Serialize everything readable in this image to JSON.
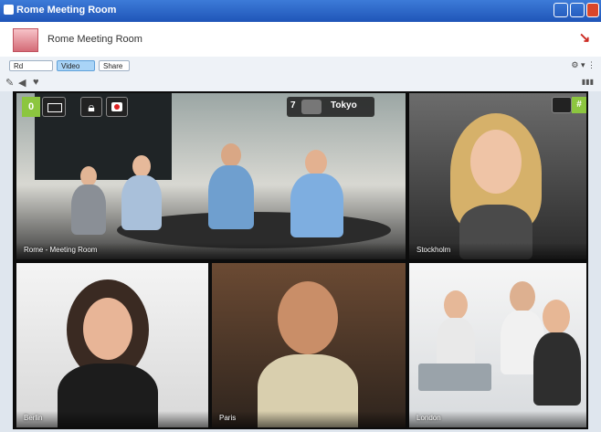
{
  "window": {
    "title": "Rome Meeting Room"
  },
  "header": {
    "room_title": "Rome Meeting Room"
  },
  "toolbar": {
    "dial_label": "Rd",
    "video_label": "Video",
    "share_label": "Share"
  },
  "overlay": {
    "participant_count": "0",
    "layout_number": "7",
    "speaker_name": "Tokyo",
    "hash_label": "#"
  },
  "tiles": [
    {
      "id": "rome",
      "label": "Rome - Meeting Room"
    },
    {
      "id": "stockholm",
      "label": "Stockholm"
    },
    {
      "id": "berlin",
      "label": "Berlin"
    },
    {
      "id": "paris",
      "label": "Paris"
    },
    {
      "id": "london",
      "label": "London"
    }
  ],
  "colors": {
    "accent_green": "#8cc63f",
    "titlebar": "#2a62c7",
    "hangup": "#cc2a22"
  }
}
